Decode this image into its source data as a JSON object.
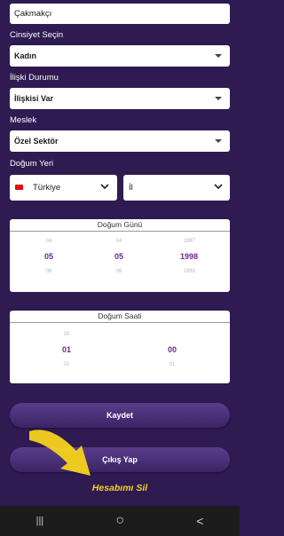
{
  "surname_value": "Çakmakçı",
  "gender": {
    "label": "Cinsiyet Seçin",
    "value": "Kadın"
  },
  "relationship": {
    "label": "İlişki Durumu",
    "value": "İlişkisi Var"
  },
  "job": {
    "label": "Meslek",
    "value": "Özel Sektör"
  },
  "birthplace": {
    "label": "Doğum Yeri",
    "country": "Türkiye",
    "city": "İl"
  },
  "birth_date": {
    "title": "Doğum Günü",
    "day": {
      "prev": "04",
      "selected": "05",
      "next": "06"
    },
    "month": {
      "prev": "04",
      "selected": "05",
      "next": "06"
    },
    "year": {
      "prev": "1997",
      "selected": "1998",
      "next": "1999"
    }
  },
  "birth_time": {
    "title": "Doğum Saati",
    "hour": {
      "prev": "00",
      "selected": "01",
      "next": "02"
    },
    "minute": {
      "selected": "00",
      "next": "01"
    }
  },
  "buttons": {
    "save": "Kaydet",
    "logout": "Çıkış Yap",
    "delete": "Hesabımı Sil"
  },
  "navbar": {
    "recent": "|||",
    "home": "○",
    "back": "<"
  },
  "colors": {
    "background": "#2f1a52",
    "accent": "#f6d31e",
    "selected_text": "#6a2a8a"
  }
}
